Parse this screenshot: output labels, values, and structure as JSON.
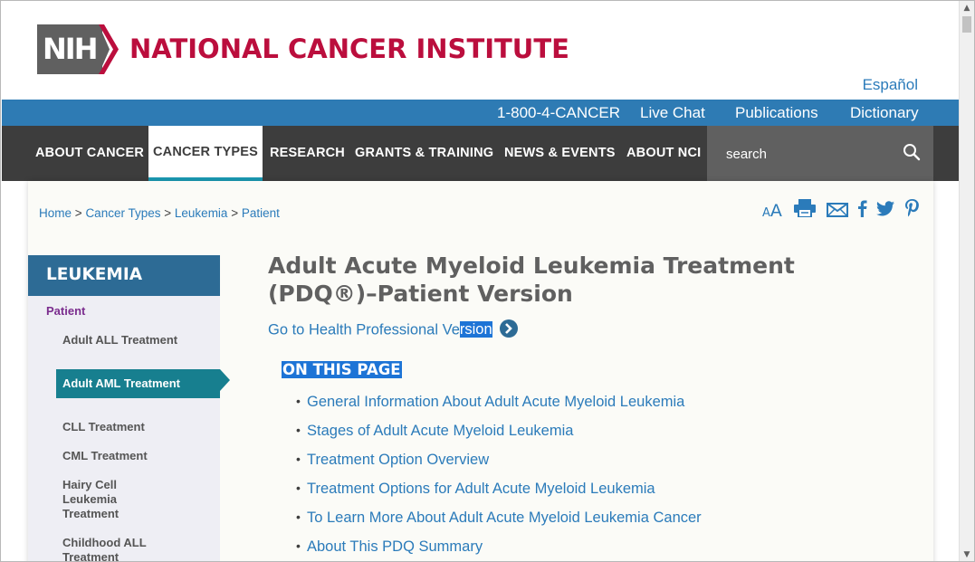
{
  "header": {
    "logo_nih": "NIH",
    "logo_title": "NATIONAL CANCER INSTITUTE",
    "language_link": "Español"
  },
  "utility_nav": [
    "1-800-4-CANCER",
    "Live Chat",
    "Publications",
    "Dictionary"
  ],
  "main_nav": {
    "items": [
      "ABOUT CANCER",
      "CANCER TYPES",
      "RESEARCH",
      "GRANTS & TRAINING",
      "NEWS & EVENTS",
      "ABOUT NCI"
    ],
    "active": "CANCER TYPES",
    "search_placeholder": "search"
  },
  "breadcrumb": {
    "items": [
      "Home",
      "Cancer Types",
      "Leukemia",
      "Patient"
    ],
    "separator": ">"
  },
  "tools": [
    "font-resize-icon",
    "print-icon",
    "email-icon",
    "facebook-icon",
    "twitter-icon",
    "pinterest-icon"
  ],
  "tools_font_label": "AA",
  "left_nav": {
    "title": "LEUKEMIA",
    "section": "Patient",
    "items": [
      {
        "label": "Adult ALL Treatment",
        "active": false
      },
      {
        "label": "Adult AML Treatment",
        "active": true
      },
      {
        "label": "CLL Treatment",
        "active": false
      },
      {
        "label": "CML Treatment",
        "active": false
      },
      {
        "label": "Hairy Cell Leukemia Treatment",
        "active": false
      },
      {
        "label": "Childhood ALL Treatment",
        "active": false
      }
    ]
  },
  "content": {
    "title": "Adult Acute Myeloid Leukemia Treatment (PDQ®)–Patient Version",
    "hp_link_prefix": "Go to Health Professional Ve",
    "hp_link_selected": "rsion",
    "on_this_page": "ON THIS PAGE",
    "toc": [
      "General Information About Adult Acute Myeloid Leukemia",
      "Stages of Adult Acute Myeloid Leukemia",
      "Treatment Option Overview",
      "Treatment Options for Adult Acute Myeloid Leukemia",
      "To Learn More About Adult Acute Myeloid Leukemia Cancer",
      "About This PDQ Summary"
    ]
  },
  "colors": {
    "brand_red": "#bb0e3d",
    "utility_blue": "#2e7bb4",
    "nav_dark": "#3d3d3d",
    "leftnav_head": "#2d6b95",
    "active_teal": "#177f8f",
    "link_blue": "#2b7bba",
    "selection_blue": "#1d74d6"
  }
}
